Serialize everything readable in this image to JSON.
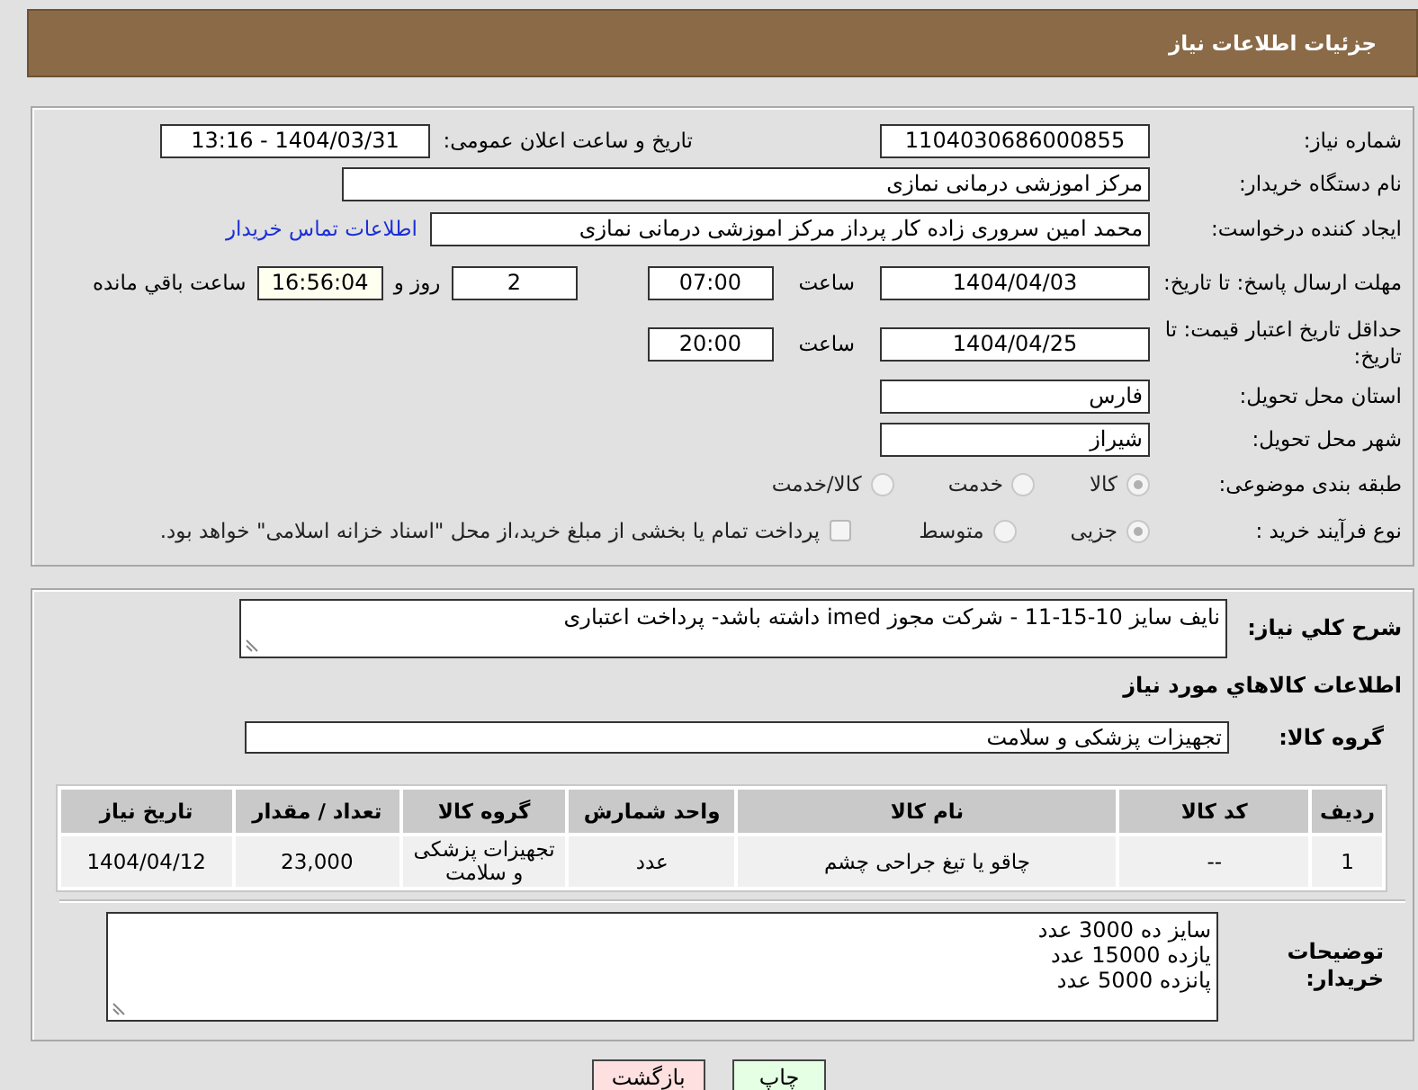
{
  "header": {
    "title": "جزئیات اطلاعات نیاز"
  },
  "need_number": {
    "label": "شماره نیاز:",
    "value": "1104030686000855"
  },
  "announce": {
    "label": "تاریخ و ساعت اعلان عمومی:",
    "value": "1404/03/31 - 13:16"
  },
  "buyer": {
    "label": "نام دستگاه خریدار:",
    "value": "مرکز اموزشی درمانی نمازی"
  },
  "creator": {
    "label": "ایجاد کننده درخواست:",
    "value": "محمد امین سروری زاده کار پرداز مرکز اموزشی درمانی نمازی",
    "link": "اطلاعات تماس خریدار"
  },
  "deadline": {
    "label": "مهلت ارسال پاسخ: تا تاریخ:",
    "date": "1404/04/03",
    "time_label": "ساعت",
    "time": "07:00",
    "days": "2",
    "days_label": "روز و",
    "remaining": "16:56:04",
    "remaining_label": "ساعت باقي مانده"
  },
  "validity": {
    "label": "حداقل تاریخ اعتبار قیمت: تا تاریخ:",
    "date": "1404/04/25",
    "time_label": "ساعت",
    "time": "20:00"
  },
  "province": {
    "label": "استان محل تحویل:",
    "value": "فارس"
  },
  "city": {
    "label": "شهر محل تحویل:",
    "value": "شیراز"
  },
  "category": {
    "label": "طبقه بندی موضوعی:",
    "options": [
      {
        "label": "کالا",
        "selected": true
      },
      {
        "label": "خدمت",
        "selected": false
      },
      {
        "label": "کالا/خدمت",
        "selected": false
      }
    ]
  },
  "process": {
    "label": "نوع فرآیند خرید :",
    "options": [
      {
        "label": "جزیی",
        "selected": true
      },
      {
        "label": "متوسط",
        "selected": false
      }
    ],
    "treasury": {
      "label": "پرداخت تمام یا بخشی از مبلغ خرید،از محل \"اسناد خزانه اسلامی\" خواهد بود.",
      "checked": false
    }
  },
  "description": {
    "label": "شرح کلي نیاز:",
    "value": "نایف سایز 10-15-11  - شرکت مجوز imed داشته باشد- پرداخت اعتباری"
  },
  "goods_heading": "اطلاعات کالاهاي مورد نیاز",
  "goods_group": {
    "label": "گروه کالا:",
    "value": "تجهیزات پزشکی و سلامت"
  },
  "table": {
    "columns": [
      "ردیف",
      "کد کالا",
      "نام کالا",
      "واحد شمارش",
      "گروه کالا",
      "تعداد / مقدار",
      "تاریخ نیاز"
    ],
    "rows": [
      [
        "1",
        "--",
        "چاقو یا تیغ جراحی چشم",
        "عدد",
        "تجهیزات پزشکی و سلامت",
        "23,000",
        "1404/04/12"
      ]
    ]
  },
  "notes": {
    "label": "توضیحات خریدار:",
    "lines": [
      "سایز ده 3000 عدد",
      "یازده 15000 عدد",
      "پانزده 5000 عدد"
    ]
  },
  "buttons": [
    {
      "label": "چاپ",
      "kind": "print"
    },
    {
      "label": "بازگشت",
      "kind": "back"
    }
  ]
}
